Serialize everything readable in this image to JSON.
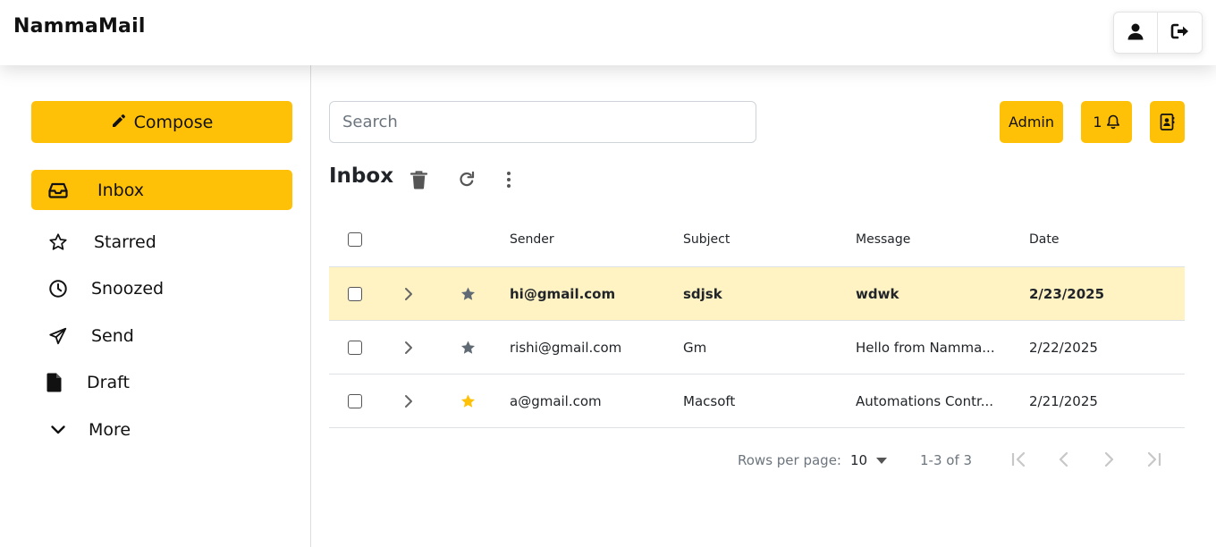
{
  "app": {
    "title": "NammaMail"
  },
  "icons": {
    "profile": "person-icon",
    "logout": "logout-icon",
    "compose": "pencil-icon",
    "inbox": "inbox-tray-icon",
    "starred": "star-outline-icon",
    "snoozed": "clock-icon",
    "send": "paper-plane-icon",
    "draft": "file-icon",
    "more": "chevron-down-icon",
    "delete": "trash-icon",
    "refresh": "refresh-icon",
    "menu": "kebab-menu-icon",
    "notifications": "bell-icon",
    "contacts": "contact-book-icon"
  },
  "colors": {
    "accent": "#ffc107",
    "unread_row": "#fff3c4",
    "star_active": "#ffc107",
    "star_inactive": "#5f6a75"
  },
  "sidebar": {
    "compose_label": "Compose",
    "items": [
      {
        "label": "Inbox",
        "active": true
      },
      {
        "label": "Starred"
      },
      {
        "label": "Snoozed"
      },
      {
        "label": "Send"
      },
      {
        "label": "Draft"
      },
      {
        "label": "More"
      }
    ]
  },
  "toolbar": {
    "search_placeholder": "Search",
    "admin_label": "Admin",
    "notification_count": "1"
  },
  "inbox": {
    "title": "Inbox",
    "columns": {
      "sender": "Sender",
      "subject": "Subject",
      "message": "Message",
      "date": "Date"
    },
    "rows": [
      {
        "sender": "hi@gmail.com",
        "subject": "sdjsk",
        "message": "wdwk",
        "date": "2/23/2025",
        "starred": false,
        "unread": true
      },
      {
        "sender": "rishi@gmail.com",
        "subject": "Gm",
        "message": "Hello from Namma...",
        "date": "2/22/2025",
        "starred": false,
        "unread": false
      },
      {
        "sender": "a@gmail.com",
        "subject": "Macsoft",
        "message": "Automations Contr...",
        "date": "2/21/2025",
        "starred": true,
        "unread": false
      }
    ]
  },
  "pagination": {
    "rows_per_page_label": "Rows per page:",
    "rows_per_page_value": "10",
    "range_label": "1-3 of 3"
  }
}
